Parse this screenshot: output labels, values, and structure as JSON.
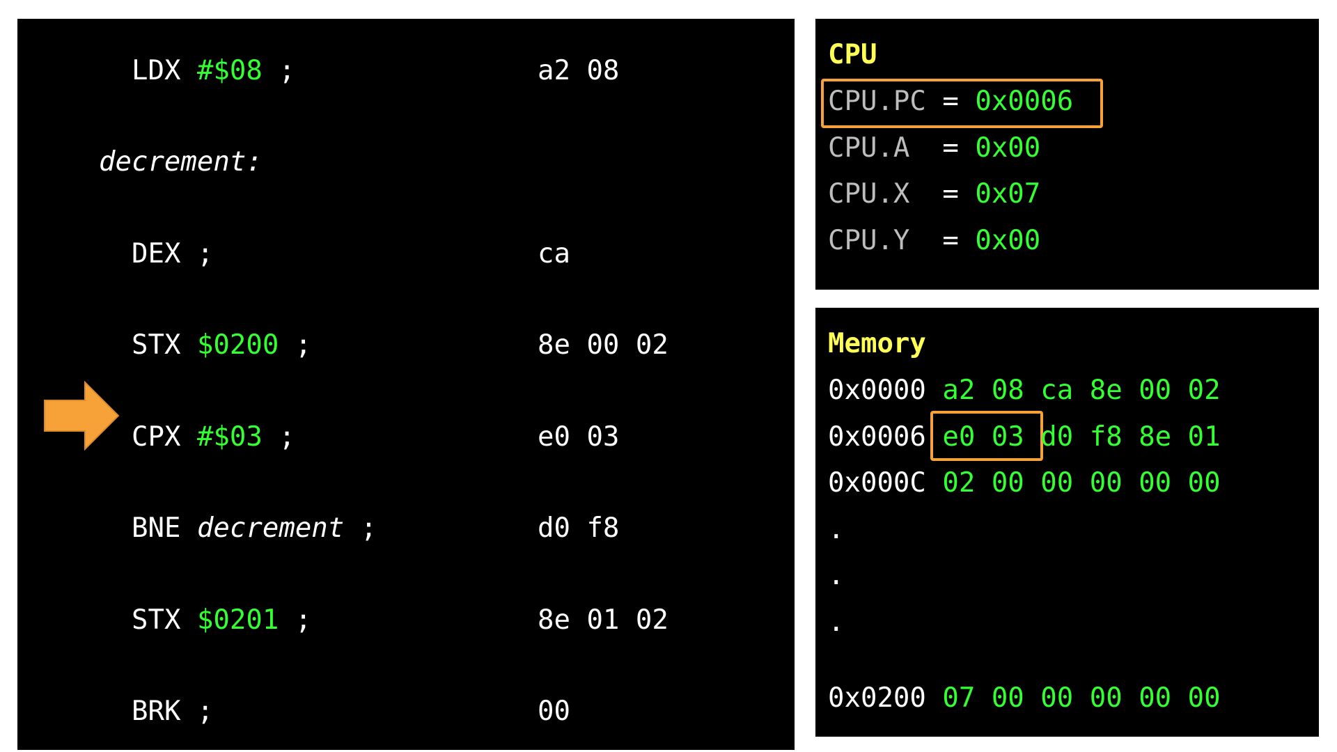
{
  "code": {
    "lines": [
      {
        "op": "LDX",
        "arg": "#$08",
        "arg_style": "immediate",
        "comment": ";",
        "bytes": "a2 08"
      },
      {
        "label": "decrement:"
      },
      {
        "op": "DEX",
        "arg": "",
        "comment": ";",
        "bytes": "ca"
      },
      {
        "op": "STX",
        "arg": "$0200",
        "arg_style": "address",
        "comment": ";",
        "bytes": "8e 00 02"
      },
      {
        "op": "CPX",
        "arg": "#$03",
        "arg_style": "immediate",
        "comment": ";",
        "bytes": "e0 03",
        "current": true
      },
      {
        "op": "BNE",
        "arg": "decrement",
        "arg_style": "label",
        "comment": ";",
        "bytes": "d0 f8"
      },
      {
        "op": "STX",
        "arg": "$0201",
        "arg_style": "address",
        "comment": ";",
        "bytes": "8e 01 02"
      },
      {
        "op": "BRK",
        "arg": "",
        "comment": ";",
        "bytes": "00"
      }
    ]
  },
  "cpu": {
    "title": "CPU",
    "registers": [
      {
        "name": "CPU.PC",
        "eq": "=",
        "value": "0x0006",
        "highlighted": true
      },
      {
        "name": "CPU.A",
        "eq": "=",
        "value": "0x00"
      },
      {
        "name": "CPU.X",
        "eq": "=",
        "value": "0x07"
      },
      {
        "name": "CPU.Y",
        "eq": "=",
        "value": "0x00"
      }
    ]
  },
  "memory": {
    "title": "Memory",
    "rows": [
      {
        "addr": "0x0000",
        "bytes": [
          "a2",
          "08",
          "ca",
          "8e",
          "00",
          "02"
        ]
      },
      {
        "addr": "0x0006",
        "bytes": [
          "e0",
          "03",
          "d0",
          "f8",
          "8e",
          "01"
        ],
        "highlight_bytes": 2
      },
      {
        "addr": "0x000C",
        "bytes": [
          "02",
          "00",
          "00",
          "00",
          "00",
          "00"
        ]
      }
    ],
    "ellipsis": [
      ".",
      ".",
      "."
    ],
    "tail_row": {
      "addr": "0x0200",
      "bytes": [
        "07",
        "00",
        "00",
        "00",
        "00",
        "00"
      ]
    }
  },
  "colors": {
    "panel_bg": "#000000",
    "text": "#ffffff",
    "accent_green": "#33ff33",
    "title_yellow": "#ffff55",
    "register_gray": "#bdbdbd",
    "highlight_orange": "#f6a239"
  },
  "icons": {
    "pc_pointer": "arrow-right-icon"
  }
}
